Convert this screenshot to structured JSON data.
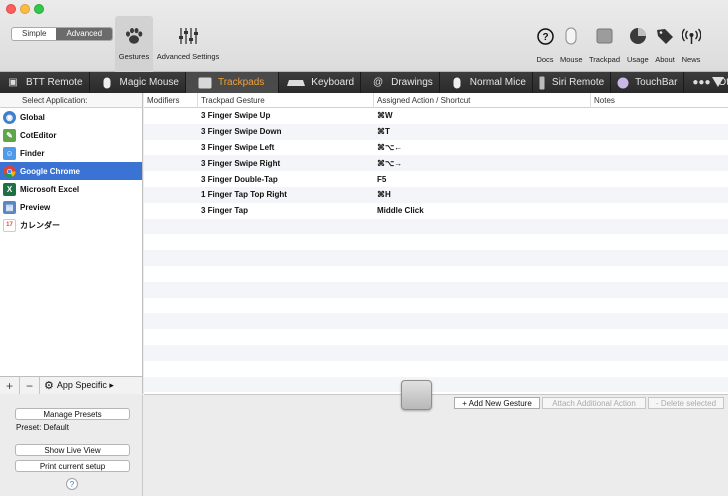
{
  "toolbar": {
    "mode_simple": "Simple",
    "mode_advanced": "Advanced",
    "gestures_label": "Gestures",
    "advanced_settings_label": "Advanced Settings",
    "right": [
      {
        "label": "Docs",
        "icon": "help-circle-icon",
        "glyph": "?"
      },
      {
        "label": "Mouse",
        "icon": "mouse-icon",
        "glyph": ""
      },
      {
        "label": "Trackpad",
        "icon": "trackpad-icon",
        "glyph": ""
      },
      {
        "label": "Usage",
        "icon": "pie-chart-icon",
        "glyph": ""
      },
      {
        "label": "About",
        "icon": "tag-icon",
        "glyph": ""
      },
      {
        "label": "News",
        "icon": "broadcast-icon",
        "glyph": "((•))"
      }
    ]
  },
  "devices": [
    {
      "label": "BTT Remote",
      "icon": "remote-icon"
    },
    {
      "label": "Magic Mouse",
      "icon": "magic-mouse-icon"
    },
    {
      "label": "Trackpads",
      "icon": "trackpad-icon",
      "active": true
    },
    {
      "label": "Keyboard",
      "icon": "keyboard-icon"
    },
    {
      "label": "Drawings",
      "icon": "drawing-spiral-icon"
    },
    {
      "label": "Normal Mice",
      "icon": "normal-mouse-icon"
    },
    {
      "label": "Siri Remote",
      "icon": "siri-remote-icon"
    },
    {
      "label": "TouchBar",
      "icon": "touchbar-icon"
    },
    {
      "label": "Other",
      "icon": "more-dots-icon"
    }
  ],
  "sidebar": {
    "header": "Select Application:",
    "apps": [
      {
        "name": "Global",
        "icon": "globe-icon",
        "color": "#3f7fd0",
        "glyph": "◉"
      },
      {
        "name": "CotEditor",
        "icon": "coteditor-icon",
        "color": "#5fa54a",
        "glyph": "✎"
      },
      {
        "name": "Finder",
        "icon": "finder-icon",
        "color": "#4f9be8",
        "glyph": "☺"
      },
      {
        "name": "Google Chrome",
        "icon": "chrome-icon",
        "color": "#e8a03a",
        "glyph": "◍",
        "selected": true
      },
      {
        "name": "Microsoft Excel",
        "icon": "excel-icon",
        "color": "#1e7145",
        "glyph": "X"
      },
      {
        "name": "Preview",
        "icon": "preview-icon",
        "color": "#5a86c8",
        "glyph": "▤"
      },
      {
        "name": "カレンダー",
        "icon": "calendar-icon",
        "color": "#d94b3b",
        "glyph": "17"
      }
    ],
    "add_label": "+",
    "remove_label": "−",
    "app_specific_label": "App Specific ▸"
  },
  "presets": {
    "manage_label": "Manage Presets",
    "current_label": "Preset: Default",
    "live_view_label": "Show Live View",
    "print_label": "Print current setup",
    "help_label": "?"
  },
  "table": {
    "headers": [
      "Modifiers",
      "Trackpad Gesture",
      "Assigned Action / Shortcut",
      "Notes"
    ],
    "rows": [
      {
        "modifiers": "",
        "gesture": "3 Finger Swipe Up",
        "action": "⌘W",
        "notes": ""
      },
      {
        "modifiers": "",
        "gesture": "3 Finger Swipe Down",
        "action": "⌘T",
        "notes": ""
      },
      {
        "modifiers": "",
        "gesture": "3 Finger Swipe Left",
        "action": "⌘⌥←",
        "notes": ""
      },
      {
        "modifiers": "",
        "gesture": "3 Finger Swipe Right",
        "action": "⌘⌥→",
        "notes": ""
      },
      {
        "modifiers": "",
        "gesture": "3 Finger Double-Tap",
        "action": "F5",
        "notes": ""
      },
      {
        "modifiers": "",
        "gesture": "1 Finger Tap Top Right",
        "action": "⌘H",
        "notes": ""
      },
      {
        "modifiers": "",
        "gesture": "3 Finger Tap",
        "action": "Middle Click",
        "notes": ""
      },
      {
        "modifiers": "",
        "gesture": "",
        "action": "",
        "notes": ""
      },
      {
        "modifiers": "",
        "gesture": "",
        "action": "",
        "notes": ""
      },
      {
        "modifiers": "",
        "gesture": "",
        "action": "",
        "notes": ""
      },
      {
        "modifiers": "",
        "gesture": "",
        "action": "",
        "notes": ""
      },
      {
        "modifiers": "",
        "gesture": "",
        "action": "",
        "notes": ""
      },
      {
        "modifiers": "",
        "gesture": "",
        "action": "",
        "notes": ""
      },
      {
        "modifiers": "",
        "gesture": "",
        "action": "",
        "notes": ""
      },
      {
        "modifiers": "",
        "gesture": "",
        "action": "",
        "notes": ""
      },
      {
        "modifiers": "",
        "gesture": "",
        "action": "",
        "notes": ""
      },
      {
        "modifiers": "",
        "gesture": "",
        "action": "",
        "notes": ""
      },
      {
        "modifiers": "",
        "gesture": "",
        "action": "",
        "notes": ""
      }
    ]
  },
  "actions": {
    "add_label": "+ Add New Gesture",
    "attach_label": "Attach Additional Action",
    "delete_label": "- Delete selected"
  }
}
